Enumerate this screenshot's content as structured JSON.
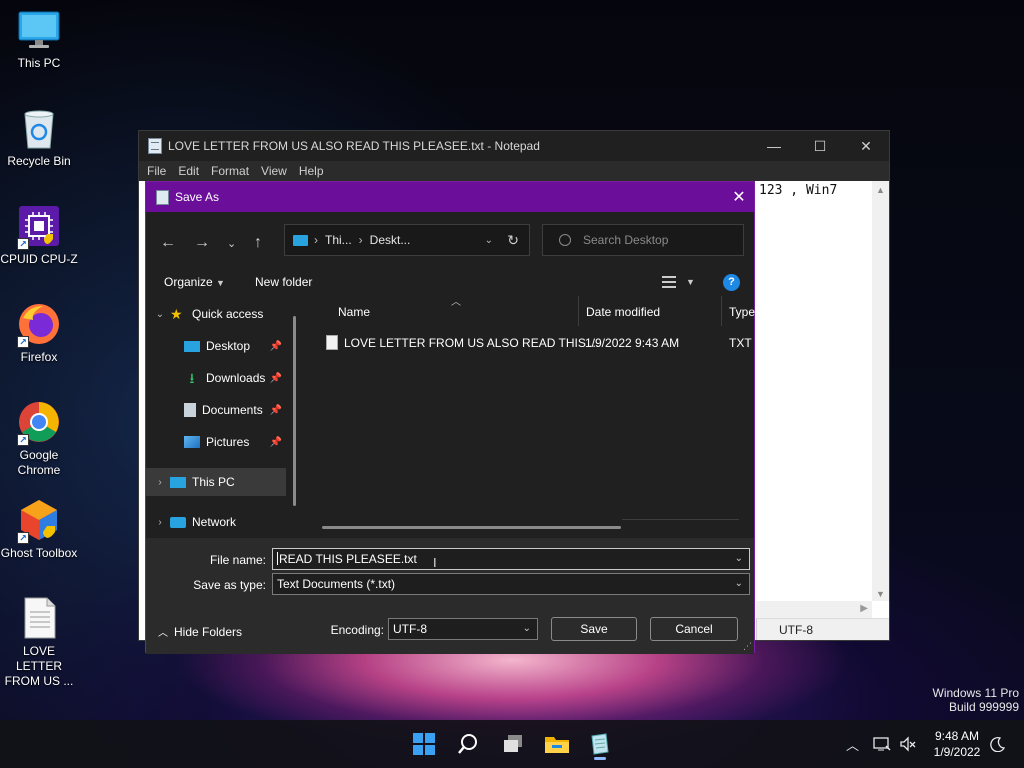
{
  "desktop": {
    "icons": [
      {
        "label": "This PC",
        "icon": "this-pc-icon"
      },
      {
        "label": "Recycle Bin",
        "icon": "recycle-bin-icon"
      },
      {
        "label": "CPUID CPU-Z",
        "icon": "cpu-z-icon"
      },
      {
        "label": "Firefox",
        "icon": "firefox-icon"
      },
      {
        "label": "Google Chrome",
        "icon": "chrome-icon"
      },
      {
        "label": "Ghost Toolbox",
        "icon": "ghost-toolbox-icon"
      },
      {
        "label": "LOVE LETTER FROM US ...",
        "icon": "text-file-icon"
      }
    ]
  },
  "notepad": {
    "title": "LOVE LETTER FROM US ALSO READ THIS PLEASEE.txt - Notepad",
    "menu": [
      "File",
      "Edit",
      "Format",
      "View",
      "Help"
    ],
    "visible_text": "123 , Win7",
    "encoding_status": "UTF-8"
  },
  "dialog": {
    "title": "Save As",
    "address": {
      "part1": "Thi...",
      "part2": "Deskt..."
    },
    "search_placeholder": "Search Desktop",
    "organize_label": "Organize",
    "new_folder_label": "New folder",
    "nav": {
      "quick_access": "Quick access",
      "desktop": "Desktop",
      "downloads": "Downloads",
      "documents": "Documents",
      "pictures": "Pictures",
      "this_pc": "This PC",
      "network": "Network"
    },
    "columns": {
      "name": "Name",
      "date_modified": "Date modified",
      "type": "Type"
    },
    "files": [
      {
        "name": "LOVE LETTER FROM US ALSO READ THIS ...",
        "date": "1/9/2022 9:43 AM",
        "type": "TXT F"
      }
    ],
    "file_name_label": "File name:",
    "file_name_value": "READ THIS PLEASEE.txt",
    "save_type_label": "Save as type:",
    "save_type_value": "Text Documents (*.txt)",
    "hide_folders_label": "Hide Folders",
    "encoding_label": "Encoding:",
    "encoding_value": "UTF-8",
    "save_label": "Save",
    "cancel_label": "Cancel"
  },
  "watermark": {
    "line1": "Windows 11 Pro",
    "line2": "Build 999999"
  },
  "taskbar": {
    "time": "9:48 AM",
    "date": "1/9/2022"
  }
}
